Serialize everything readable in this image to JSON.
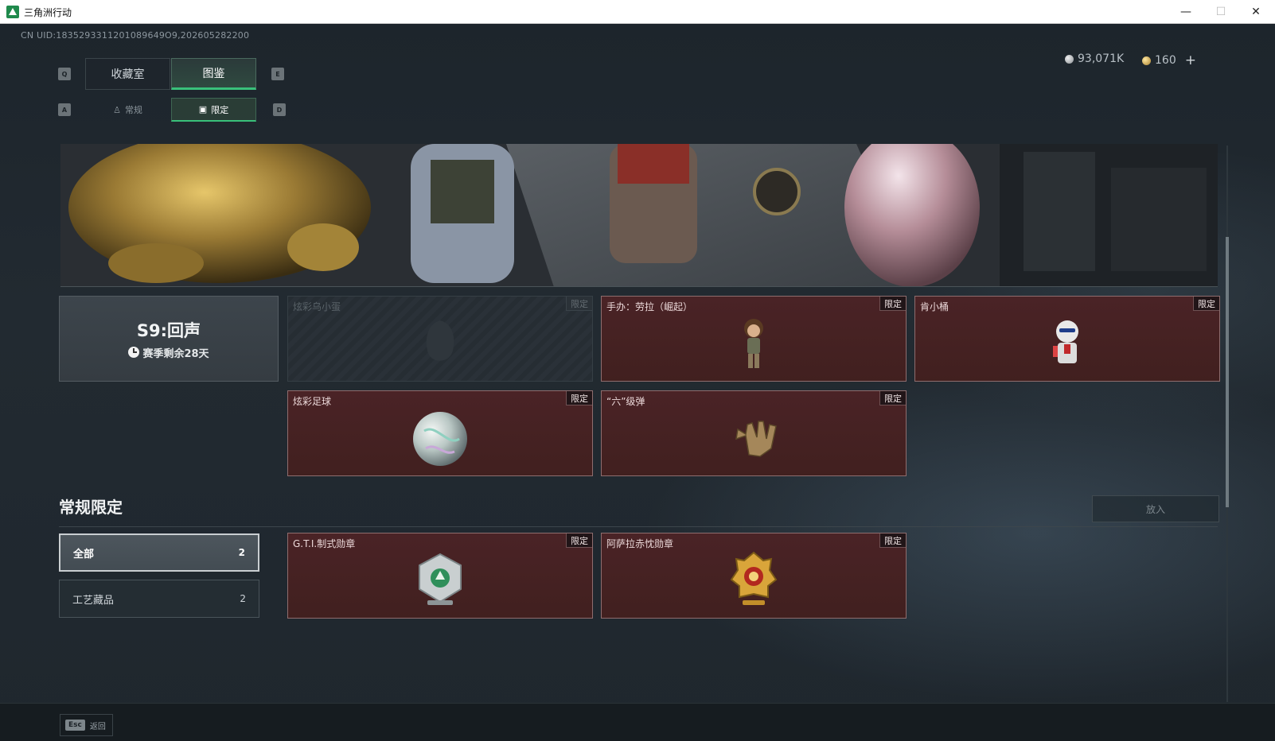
{
  "window": {
    "title": "三角洲行动",
    "minimize": "—",
    "maximize": "☐",
    "close": "✕"
  },
  "header": {
    "uid": "CN UID:1835293311201089649O9,202605282200",
    "currency_silver": "93,071K",
    "currency_gold": "160",
    "add_label": "+",
    "keys": {
      "prev_main": "Q",
      "next_main": "E",
      "prev_sub": "A",
      "next_sub": "D"
    }
  },
  "tabs": {
    "main": [
      {
        "label": "收藏室"
      },
      {
        "label": "图鉴"
      }
    ],
    "sub": [
      {
        "label": "常规"
      },
      {
        "label": "限定"
      }
    ]
  },
  "season": {
    "title": "S9:回声",
    "remaining": "赛季剩余28天"
  },
  "season_items": [
    {
      "name": "炫彩乌小蛋",
      "badge": "限定",
      "owned": false
    },
    {
      "name": "手办：劳拉（崛起）",
      "badge": "限定",
      "owned": true
    },
    {
      "name": "肯小桶",
      "badge": "限定",
      "owned": true
    },
    {
      "name": "炫彩足球",
      "badge": "限定",
      "owned": true
    },
    {
      "name": "“六”级弹",
      "badge": "限定",
      "owned": true
    }
  ],
  "section": {
    "title": "常规限定",
    "place_button": "放入"
  },
  "filters": [
    {
      "label": "全部",
      "count": "2"
    },
    {
      "label": "工艺藏品",
      "count": "2"
    }
  ],
  "regular_items": [
    {
      "name": "G.T.I.制式勋章",
      "badge": "限定"
    },
    {
      "name": "阿萨拉赤忱勋章",
      "badge": "限定"
    }
  ],
  "footer": {
    "esc_key": "Esc",
    "back_label": "返回"
  },
  "colors": {
    "accent_green": "#39c07a",
    "card_red": "#4a2326",
    "badge_dark": "#211518"
  }
}
